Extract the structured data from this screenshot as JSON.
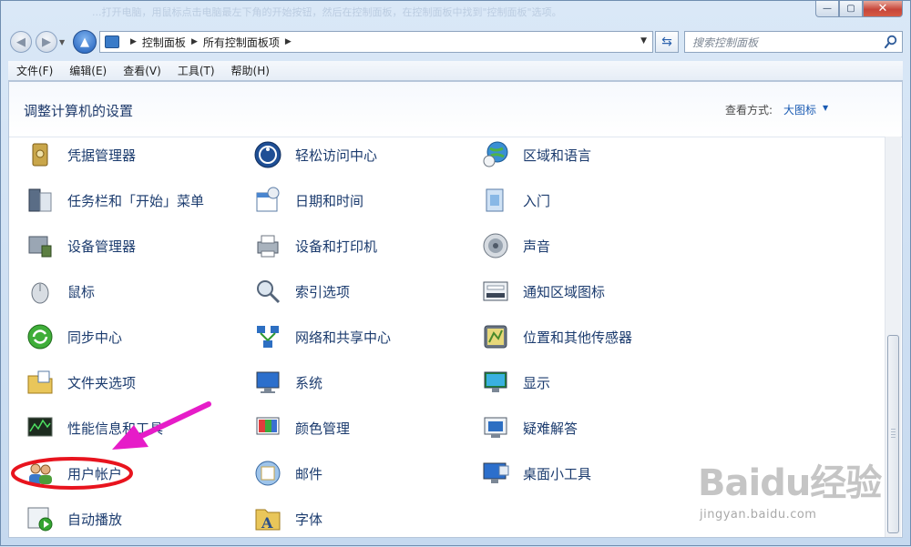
{
  "window": {
    "caption_watermark": "...打开电脑，用鼠标点击电脑最左下角的开始按钮，然后在控制面板，在控制面板中找到\"控制面板\"选项。",
    "minimize": "—",
    "maximize": "▢",
    "close": "✕"
  },
  "address": {
    "breadcrumb": [
      "控制面板",
      "所有控制面板项"
    ],
    "search_placeholder": "搜索控制面板"
  },
  "menu": [
    "文件(F)",
    "编辑(E)",
    "查看(V)",
    "工具(T)",
    "帮助(H)"
  ],
  "header": {
    "title": "调整计算机的设置",
    "view_label": "查看方式:",
    "view_value": "大图标"
  },
  "columns": [
    [
      {
        "label": "凭据管理器",
        "icon": "credential-manager-icon"
      },
      {
        "label": "任务栏和「开始」菜单",
        "icon": "taskbar-icon"
      },
      {
        "label": "设备管理器",
        "icon": "device-manager-icon"
      },
      {
        "label": "鼠标",
        "icon": "mouse-icon"
      },
      {
        "label": "同步中心",
        "icon": "sync-center-icon"
      },
      {
        "label": "文件夹选项",
        "icon": "folder-options-icon"
      },
      {
        "label": "性能信息和工具",
        "icon": "performance-icon"
      },
      {
        "label": "用户帐户",
        "icon": "user-accounts-icon"
      },
      {
        "label": "自动播放",
        "icon": "autoplay-icon"
      }
    ],
    [
      {
        "label": "轻松访问中心",
        "icon": "ease-of-access-icon"
      },
      {
        "label": "日期和时间",
        "icon": "date-time-icon"
      },
      {
        "label": "设备和打印机",
        "icon": "printer-icon"
      },
      {
        "label": "索引选项",
        "icon": "indexing-icon"
      },
      {
        "label": "网络和共享中心",
        "icon": "network-icon"
      },
      {
        "label": "系统",
        "icon": "system-icon"
      },
      {
        "label": "颜色管理",
        "icon": "color-management-icon"
      },
      {
        "label": "邮件",
        "icon": "mail-icon"
      },
      {
        "label": "字体",
        "icon": "fonts-icon"
      }
    ],
    [
      {
        "label": "区域和语言",
        "icon": "region-language-icon"
      },
      {
        "label": "入门",
        "icon": "getting-started-icon"
      },
      {
        "label": "声音",
        "icon": "sound-icon"
      },
      {
        "label": "通知区域图标",
        "icon": "notification-area-icon"
      },
      {
        "label": "位置和其他传感器",
        "icon": "location-sensor-icon"
      },
      {
        "label": "显示",
        "icon": "display-icon"
      },
      {
        "label": "疑难解答",
        "icon": "troubleshooting-icon"
      },
      {
        "label": "桌面小工具",
        "icon": "desktop-gadgets-icon"
      }
    ]
  ],
  "watermark": {
    "logo": "Baidu经验",
    "url": "jingyan.baidu.com"
  },
  "colors": {
    "annotation": "#e8141e",
    "arrow": "#e61cc8",
    "link": "#1b3b6e"
  }
}
